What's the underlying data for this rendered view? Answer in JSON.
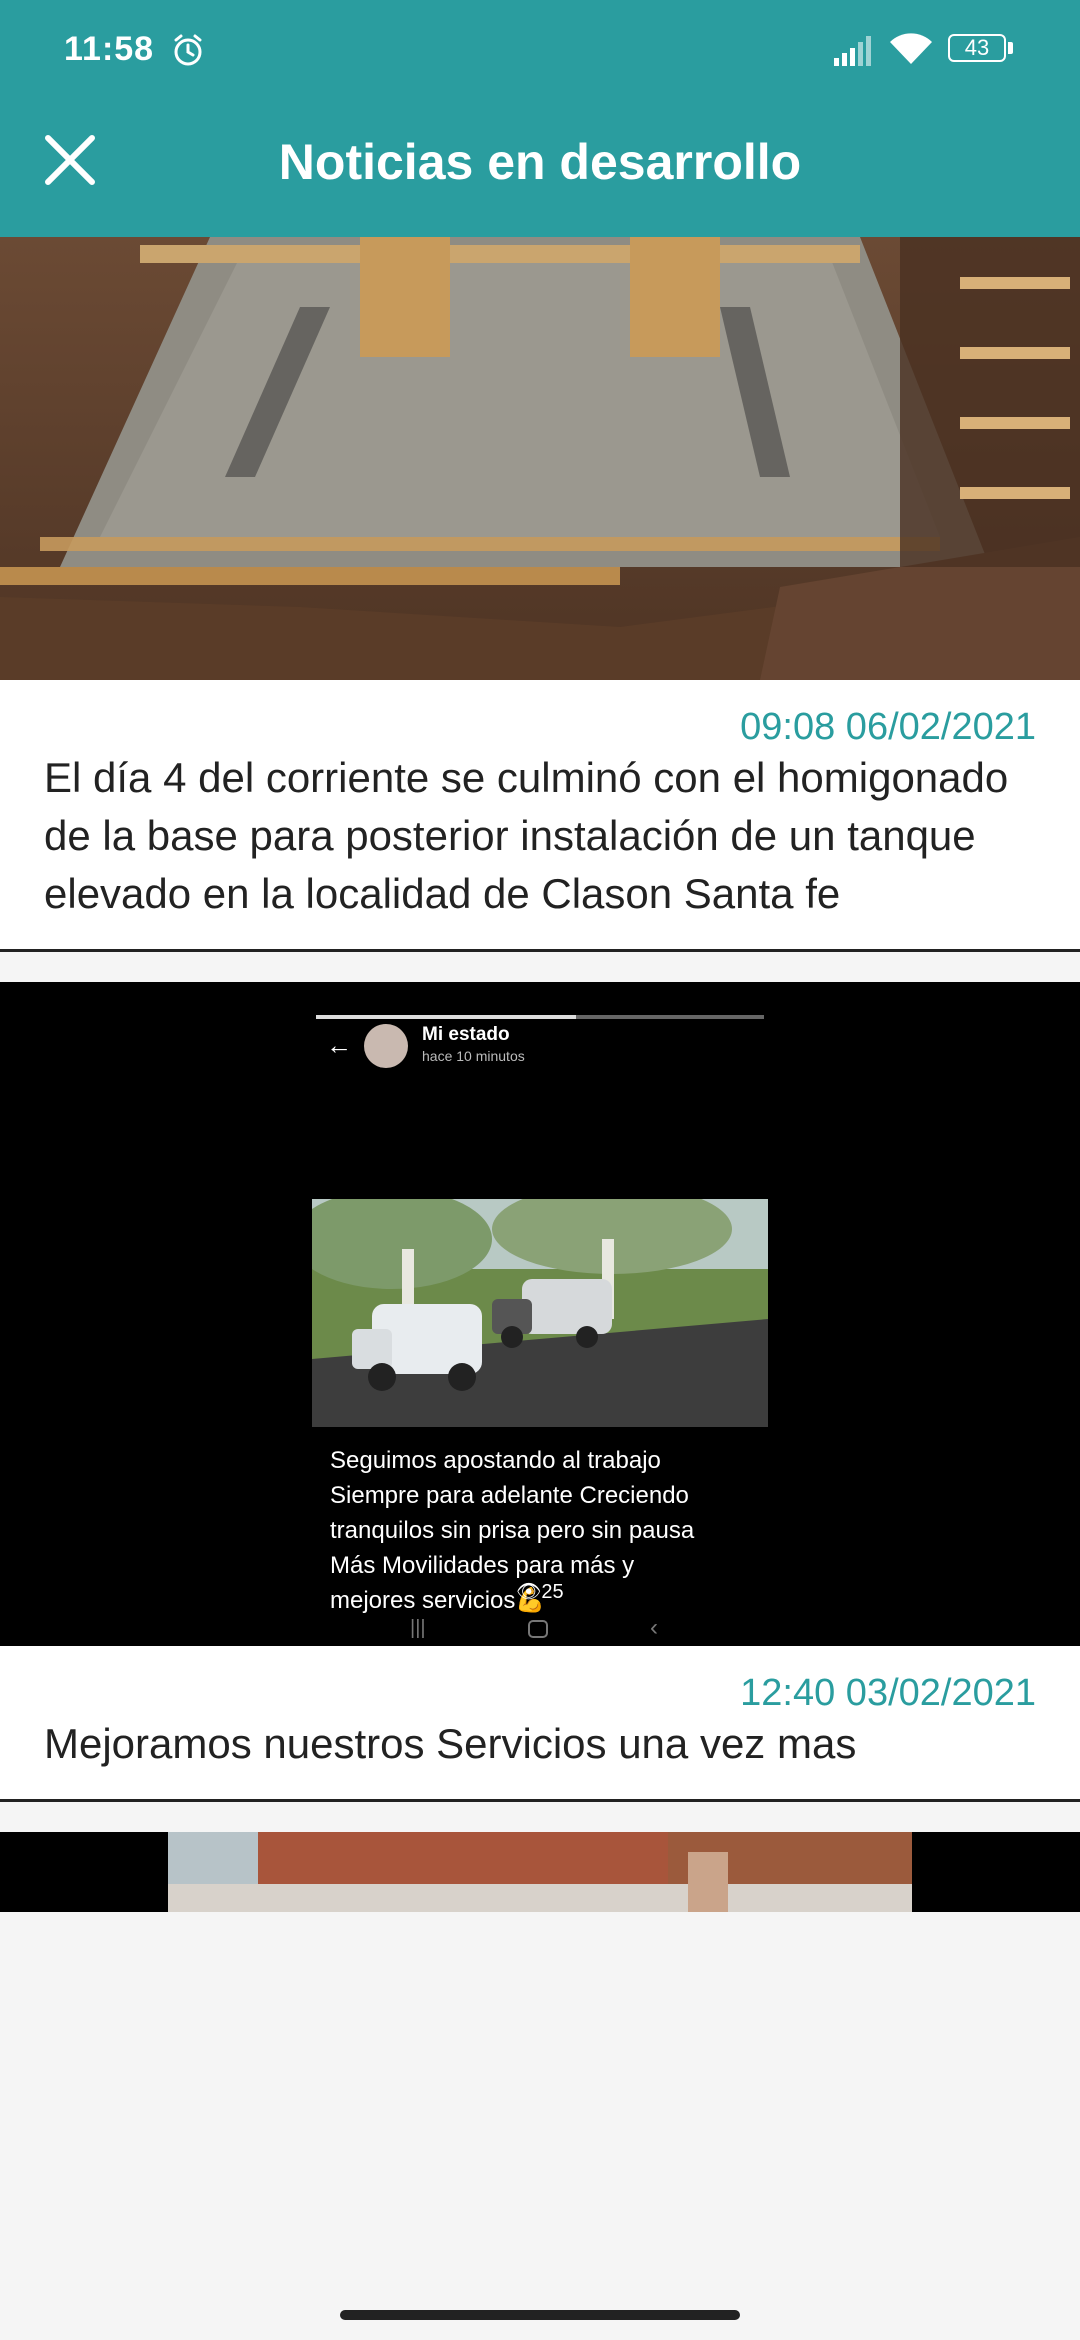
{
  "status_bar": {
    "time": "11:58",
    "battery": "43"
  },
  "header": {
    "title": "Noticias en desarrollo",
    "close_icon": "close-icon"
  },
  "news": [
    {
      "timestamp": "09:08 06/02/2021",
      "text": "El día 4 del corriente se culminó con el homigonado de la base para posterior instalación de un tanque elevado en la localidad de Clason Santa fe",
      "image": "concrete-foundation-photo"
    },
    {
      "timestamp": "12:40 03/02/2021",
      "text": "Mejoramos nuestros Servicios una vez mas",
      "image": "whatsapp-status-screenshot",
      "screenshot": {
        "title": "Mi estado",
        "subtitle": "hace 10 minutos",
        "caption_lines": [
          "Seguimos apostando al trabajo",
          "Siempre para adelante Creciendo",
          "tranquilos sin prisa pero sin pausa",
          "Más Movilidades para más y",
          "mejores servicios💪"
        ],
        "views": "25"
      }
    },
    {
      "image": "brick-wall-photo"
    }
  ]
}
